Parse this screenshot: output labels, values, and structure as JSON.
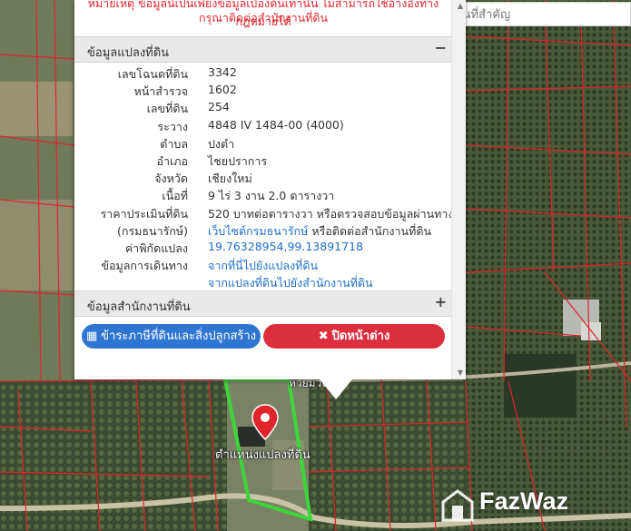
{
  "map": {
    "road_label": "ห้วยม่วง",
    "plot_marker_label": "ตำแหน่งแปลงที่ดิน",
    "watermark": "FazWaz"
  },
  "search": {
    "placeholder": "ค้นหาสถานที่สำคัญ"
  },
  "popup": {
    "warning_line1": "หมายเหตุ ข้อมูลนี้เป็นเพียงข้อมูลเบื้องต้นเท่านั้น ไม่สามารถใช้อ้างอิงทางกฎหมายได้",
    "warning_line2": "กรุณาติดต่อสำนักงานที่ดิน",
    "land_panel": {
      "title": "ข้อมูลแปลงที่ดิน",
      "toggle": "−"
    },
    "rows": [
      {
        "label": "เลขโฉนดที่ดิน",
        "value": "3342"
      },
      {
        "label": "หน้าสำรวจ",
        "value": "1602"
      },
      {
        "label": "เลขที่ดิน",
        "value": "254"
      },
      {
        "label": "ระวาง",
        "value": "4848 IV 1484-00 (4000)"
      },
      {
        "label": "ตำบล",
        "value": "ปงตำ"
      },
      {
        "label": "อำเภอ",
        "value": "ไชยปราการ"
      },
      {
        "label": "จังหวัด",
        "value": "เชียงใหม่"
      },
      {
        "label": "เนื้อที่",
        "value": "9 ไร่ 3 งาน 2.0 ตารางวา"
      },
      {
        "label": "ราคาประเมินที่ดิน",
        "value": "520 บาทต่อตารางวา หรือตรวจสอบข้อมูลผ่านทาง"
      },
      {
        "label": "(กรมธนารักษ์)",
        "value_link": "เว็บไซต์กรมธนารักษ์",
        "value_rest": " หรือติดต่อสำนักงานที่ดิน"
      },
      {
        "label": "ค่าพิกัดแปลง",
        "value": "19.76328954,99.13891718"
      },
      {
        "label": "ข้อมูลการเดินทาง",
        "value": "จากที่นี่ไปยังแปลงที่ดิน"
      },
      {
        "label": "",
        "value": "จากแปลงที่ดินไปยังสำนักงานที่ดิน"
      }
    ],
    "office_panel": {
      "title": "ข้อมูลสำนักงานที่ดิน",
      "toggle": "+"
    },
    "buttons": {
      "map_view": "ข้าระภาษีที่ดินและสิ่งปลูกสร้าง",
      "close": "ปิดหน้าต่าง"
    }
  },
  "colors": {
    "link": "#1f6fc7",
    "primary_button": "#2f76d2",
    "danger_button": "#dc2f3e",
    "warning_text": "#e0262f",
    "plot_outline": "#3cd63a",
    "parcel_lines": "#e0242c"
  }
}
